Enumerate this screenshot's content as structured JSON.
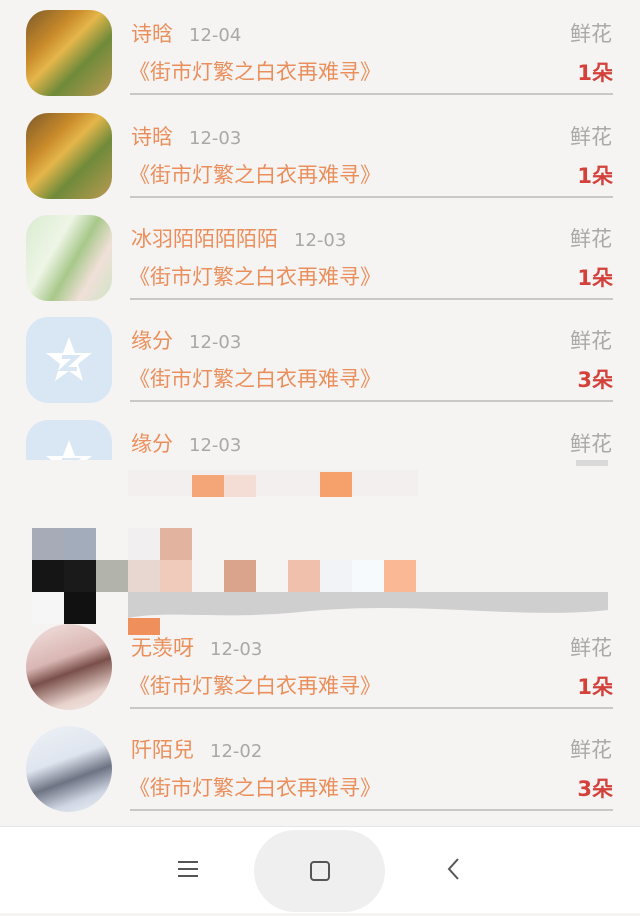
{
  "list": {
    "items": [
      {
        "name": "诗晗",
        "date": "12-04",
        "type": "鲜花",
        "book": "《街市灯繁之白衣再难寻》",
        "count": "1朵",
        "avatar": "forest"
      },
      {
        "name": "诗晗",
        "date": "12-03",
        "type": "鲜花",
        "book": "《街市灯繁之白衣再难寻》",
        "count": "1朵",
        "avatar": "forest"
      },
      {
        "name": "冰羽陌陌陌陌陌",
        "date": "12-03",
        "type": "鲜花",
        "book": "《街市灯繁之白衣再难寻》",
        "count": "1朵",
        "avatar": "girl"
      },
      {
        "name": "缘分",
        "date": "12-03",
        "type": "鲜花",
        "book": "《街市灯繁之白衣再难寻》",
        "count": "3朵",
        "avatar": "qq"
      },
      {
        "name": "缘分",
        "date": "12-03",
        "type": "鲜花",
        "avatar": "qq"
      },
      {
        "name": "无羡呀",
        "date": "12-03",
        "type": "鲜花",
        "book": "《街市灯繁之白衣再难寻》",
        "count": "1朵",
        "avatar": "girl2"
      },
      {
        "name": "阡陌兒",
        "date": "12-02",
        "type": "鲜花",
        "book": "《街市灯繁之白衣再难寻》",
        "count": "3朵",
        "avatar": "ink"
      }
    ]
  },
  "colors": {
    "accent": "#ea8f5c",
    "count": "#d3413a",
    "muted": "#a8a8a8"
  },
  "navbar": {
    "menu_icon": "menu-icon",
    "home_icon": "home-icon",
    "back_icon": "back-icon"
  }
}
